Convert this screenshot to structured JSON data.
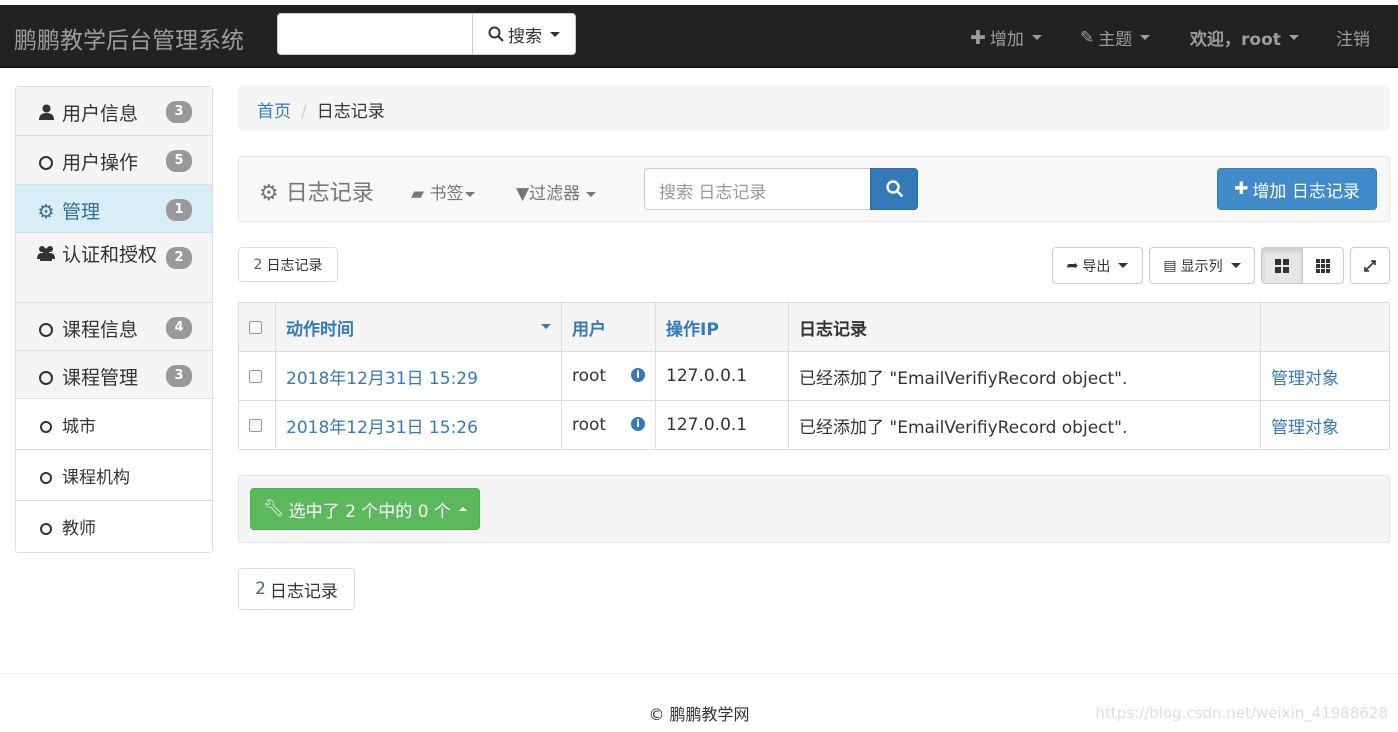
{
  "header": {
    "brand": "鹏鹏教学后台管理系统",
    "search_label": "搜索",
    "nav_add": "增加",
    "nav_theme": "主题",
    "nav_welcome": "欢迎，root",
    "nav_logout": "注销"
  },
  "sidebar": {
    "items": [
      {
        "label": "用户信息",
        "badge": "3"
      },
      {
        "label": "用户操作",
        "badge": "5"
      },
      {
        "label": "管理",
        "badge": "1"
      },
      {
        "label": "认证和授权",
        "badge": "2"
      },
      {
        "label": "课程信息",
        "badge": "4"
      },
      {
        "label": "课程管理",
        "badge": "3"
      },
      {
        "label": "城市"
      },
      {
        "label": "课程机构"
      },
      {
        "label": "教师"
      }
    ]
  },
  "breadcrumb": {
    "home": "首页",
    "current": "日志记录"
  },
  "panel": {
    "title": "日志记录",
    "bookmarks": "书签",
    "filters": "过滤器",
    "search_placeholder": "搜索 日志记录",
    "add_button": "增加 日志记录"
  },
  "toolbar": {
    "count_num": "2",
    "count_label": "日志记录",
    "export": "导出",
    "columns": "显示列"
  },
  "table": {
    "headers": [
      "动作时间",
      "用户",
      "操作IP",
      "日志记录"
    ],
    "rows": [
      {
        "time": "2018年12月31日 15:29",
        "user": "root",
        "ip": "127.0.0.1",
        "log": "已经添加了 \"EmailVerifiyRecord object\".",
        "link": "管理对象"
      },
      {
        "time": "2018年12月31日 15:26",
        "user": "root",
        "ip": "127.0.0.1",
        "log": "已经添加了 \"EmailVerifiyRecord object\".",
        "link": "管理对象"
      }
    ]
  },
  "action_bar": {
    "selected": "选中了 2 个中的 0 个"
  },
  "bottom_count": {
    "num": "2",
    "label": "日志记录"
  },
  "footer": {
    "copyright": "© 鹏鹏教学网",
    "watermark": "https://blog.csdn.net/weixin_41988628"
  }
}
